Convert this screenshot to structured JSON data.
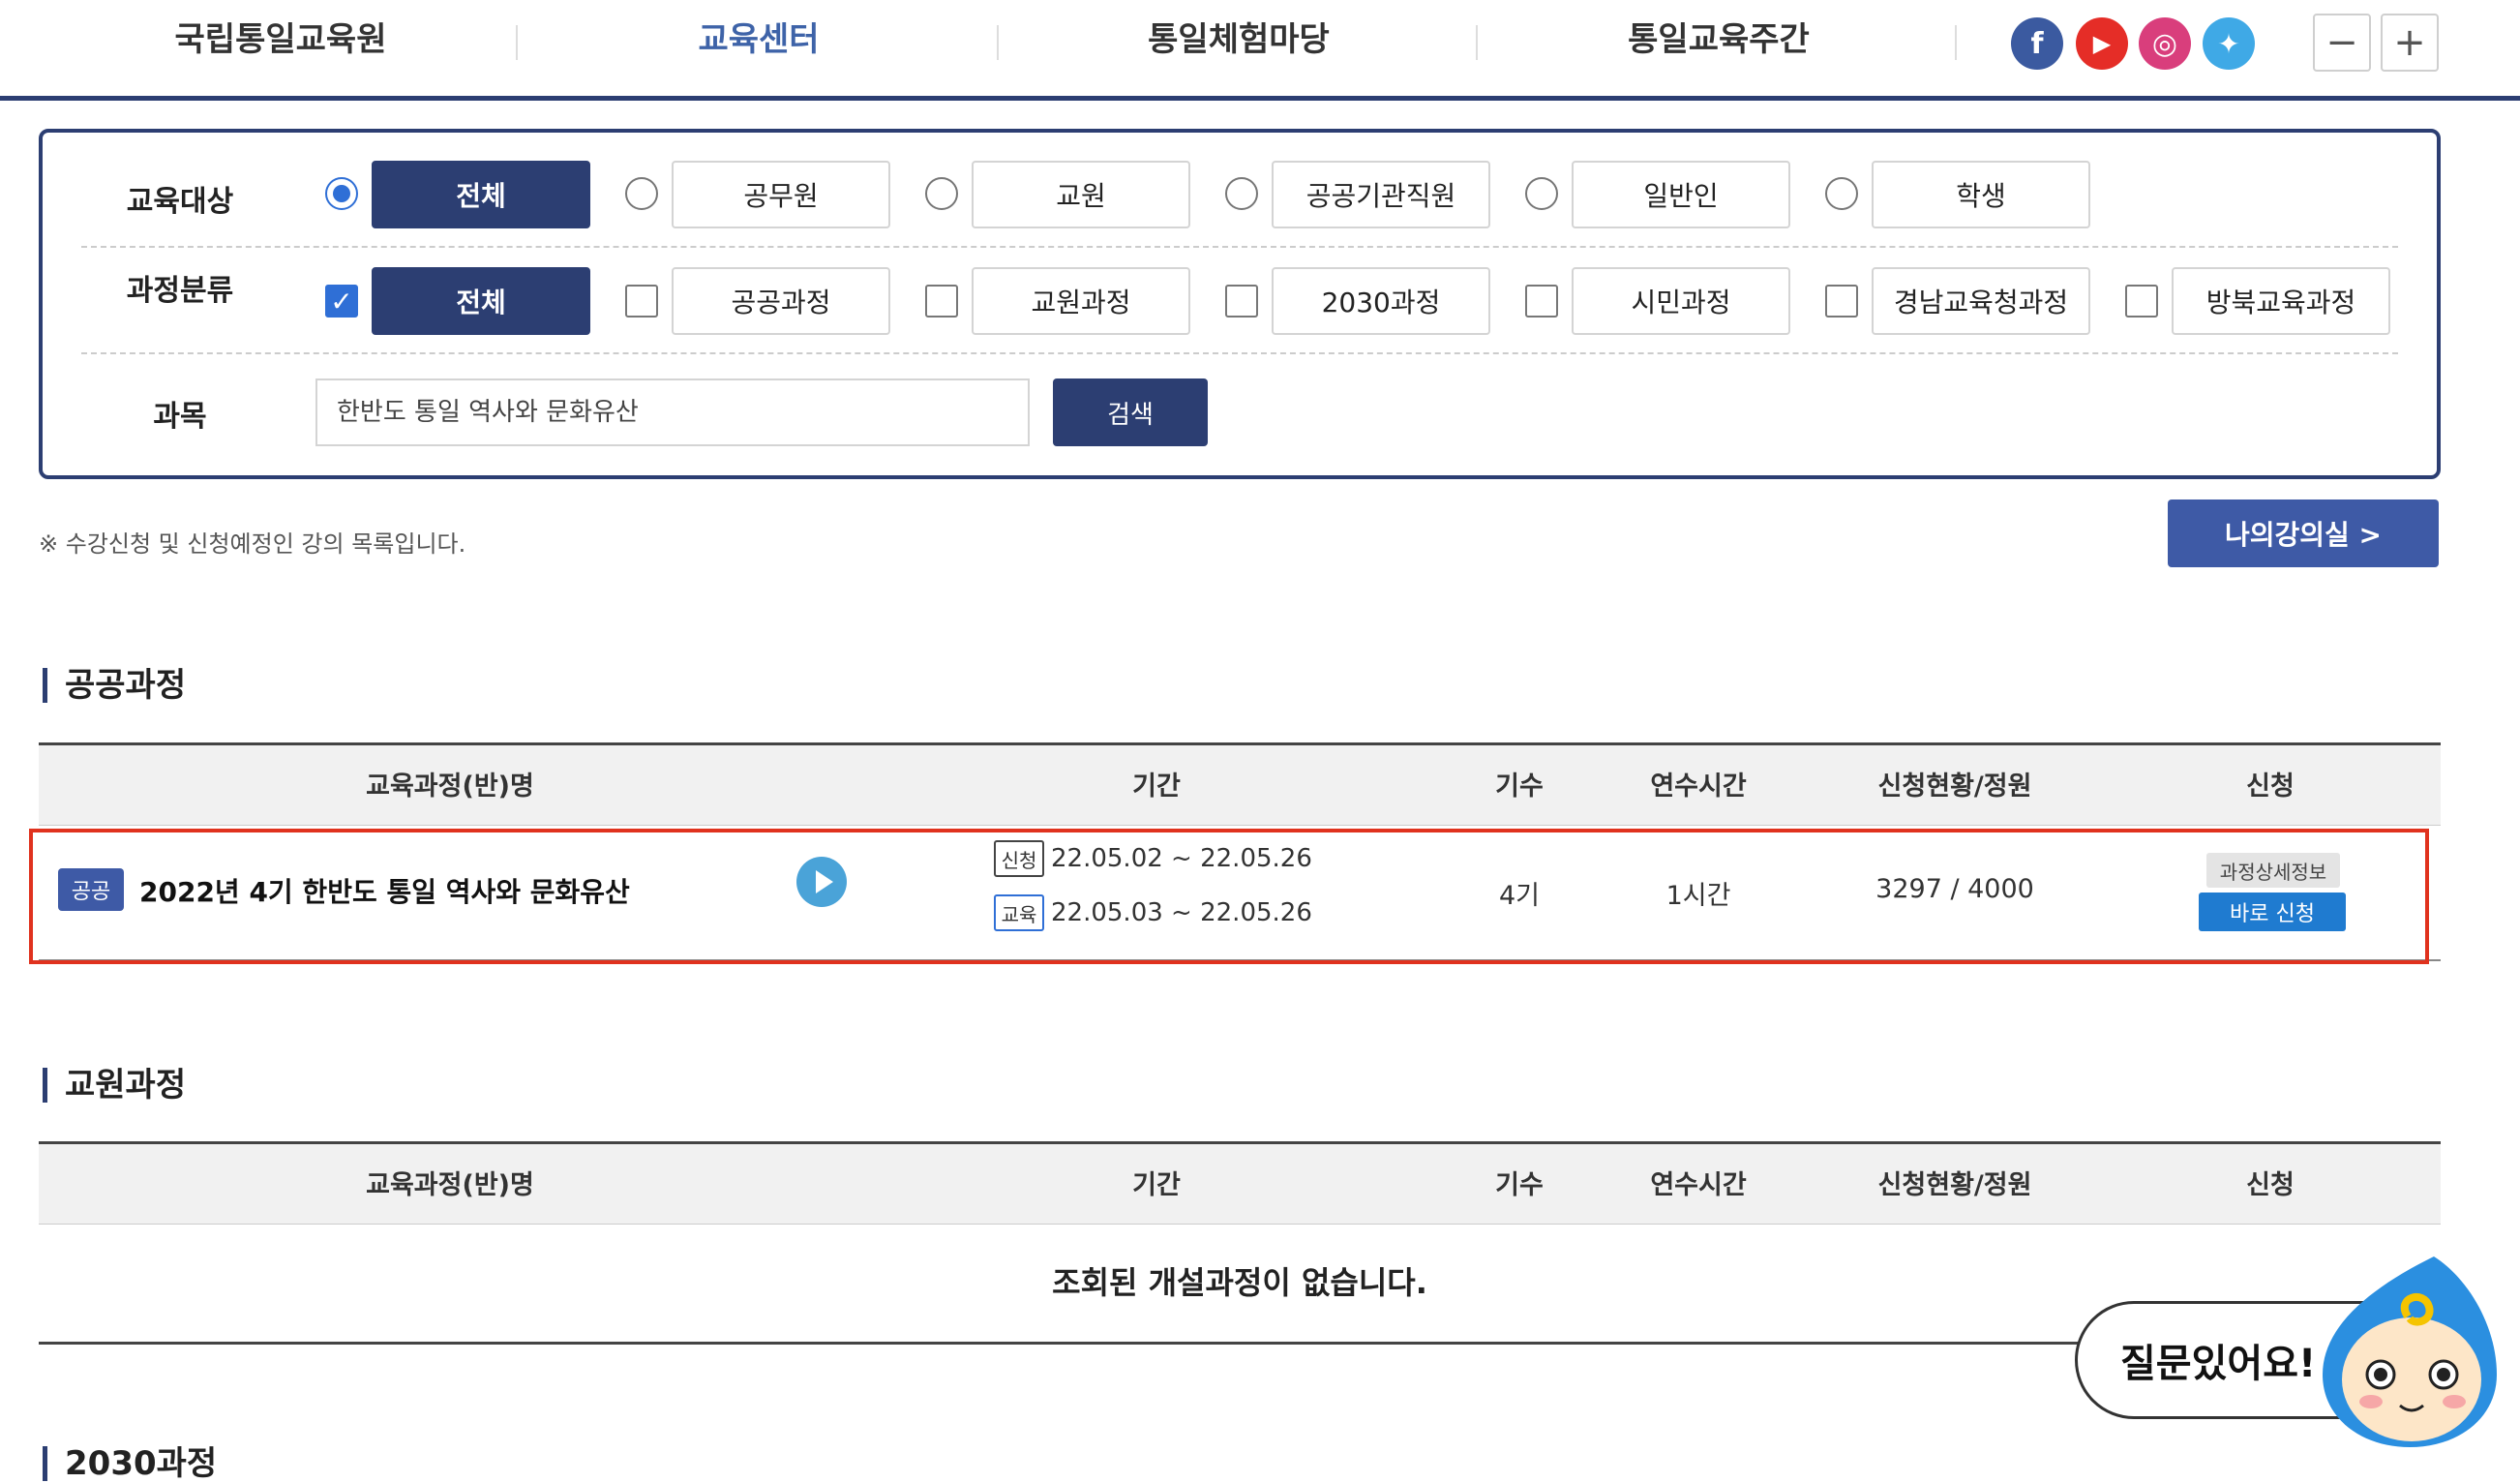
{
  "nav": {
    "items": [
      "국립통일교육원",
      "교육센터",
      "통일체험마당",
      "통일교육주간"
    ],
    "active_index": 1,
    "social": [
      {
        "name": "facebook",
        "icon": "facebook-icon",
        "glyph": "f",
        "color": "#3b5aa0"
      },
      {
        "name": "youtube",
        "icon": "youtube-icon",
        "glyph": "▶",
        "color": "#e52d27"
      },
      {
        "name": "instagram",
        "icon": "instagram-icon",
        "glyph": "◎",
        "color": "#d93e7c"
      },
      {
        "name": "twitter",
        "icon": "twitter-icon",
        "glyph": "🐦",
        "color": "#3fa9e6"
      }
    ],
    "zoom_out": "−",
    "zoom_in": "+"
  },
  "filter": {
    "target": {
      "label": "교육대상",
      "options": [
        "전체",
        "공무원",
        "교원",
        "공공기관직원",
        "일반인",
        "학생"
      ],
      "selected": "전체"
    },
    "category": {
      "label": "과정분류",
      "options": [
        "전체",
        "공공과정",
        "교원과정",
        "2030과정",
        "시민과정",
        "경남교육청과정",
        "방북교육과정"
      ],
      "checked": [
        "전체"
      ]
    },
    "subject": {
      "label": "과목",
      "value": "한반도 통일 역사와 문화유산",
      "button": "검색"
    }
  },
  "notice": "※ 수강신청 및 신청예정인 강의 목록입니다.",
  "my_classroom_button": "나의강의실 >",
  "table_headers": [
    "교육과정(반)명",
    "기간",
    "기수",
    "연수시간",
    "신청현황/정원",
    "신청"
  ],
  "sections": {
    "public": {
      "title": "공공과정",
      "row": {
        "badge": "공공",
        "name": "2022년 4기 한반도 통일 역사와 문화유산",
        "apply_tag": "신청",
        "apply_period": "22.05.02 ~ 22.05.26",
        "edu_tag": "교육",
        "edu_period": "22.05.03 ~ 22.05.26",
        "term": "4기",
        "hours": "1시간",
        "enrollment": "3297 / 4000",
        "detail_button": "과정상세정보",
        "apply_button": "바로 신청"
      }
    },
    "teacher": {
      "title": "교원과정",
      "empty_message": "조회된 개설과정이 없습니다."
    },
    "next": {
      "title": "2030과정"
    }
  },
  "chatbot": {
    "label": "질문있어요!"
  }
}
